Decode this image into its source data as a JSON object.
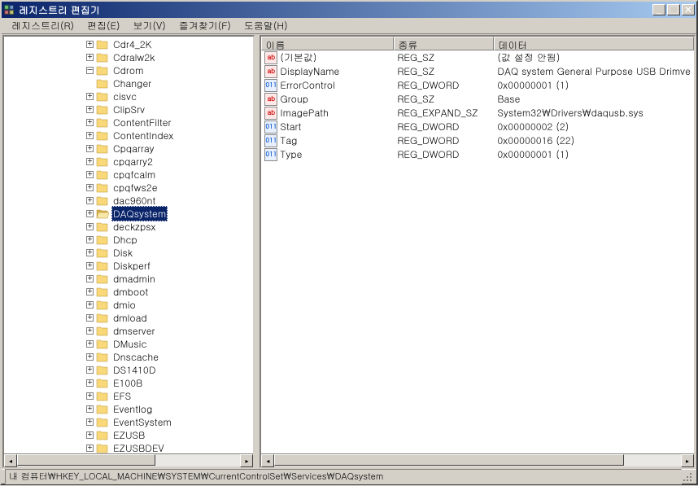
{
  "title": "레지스트리 편집기",
  "menu": {
    "registry": "레지스트리(R)",
    "edit": "편집(E)",
    "view": "보기(V)",
    "favorites": "즐겨찾기(F)",
    "help": "도움말(H)"
  },
  "tree": [
    {
      "label": "Cdr4_2K",
      "open": false,
      "selected": false
    },
    {
      "label": "Cdralw2k",
      "open": false,
      "selected": false
    },
    {
      "label": "Cdrom",
      "open": true,
      "selected": false
    },
    {
      "label": "Changer",
      "open": false,
      "selected": false,
      "noexpand": true
    },
    {
      "label": "cisvc",
      "open": false,
      "selected": false
    },
    {
      "label": "ClipSrv",
      "open": false,
      "selected": false
    },
    {
      "label": "ContentFilter",
      "open": false,
      "selected": false
    },
    {
      "label": "ContentIndex",
      "open": false,
      "selected": false
    },
    {
      "label": "Cpqarray",
      "open": false,
      "selected": false
    },
    {
      "label": "cpqarry2",
      "open": false,
      "selected": false
    },
    {
      "label": "cpqfcalm",
      "open": false,
      "selected": false
    },
    {
      "label": "cpqfws2e",
      "open": false,
      "selected": false
    },
    {
      "label": "dac960nt",
      "open": false,
      "selected": false
    },
    {
      "label": "DAQsystem",
      "open": false,
      "selected": true
    },
    {
      "label": "deckzpsx",
      "open": false,
      "selected": false
    },
    {
      "label": "Dhcp",
      "open": false,
      "selected": false
    },
    {
      "label": "Disk",
      "open": false,
      "selected": false
    },
    {
      "label": "Diskperf",
      "open": false,
      "selected": false
    },
    {
      "label": "dmadmin",
      "open": false,
      "selected": false
    },
    {
      "label": "dmboot",
      "open": false,
      "selected": false
    },
    {
      "label": "dmio",
      "open": false,
      "selected": false
    },
    {
      "label": "dmload",
      "open": false,
      "selected": false
    },
    {
      "label": "dmserver",
      "open": false,
      "selected": false
    },
    {
      "label": "DMusic",
      "open": false,
      "selected": false
    },
    {
      "label": "Dnscache",
      "open": false,
      "selected": false
    },
    {
      "label": "DS1410D",
      "open": false,
      "selected": false
    },
    {
      "label": "E100B",
      "open": false,
      "selected": false
    },
    {
      "label": "EFS",
      "open": false,
      "selected": false
    },
    {
      "label": "Eventlog",
      "open": false,
      "selected": false
    },
    {
      "label": "EventSystem",
      "open": false,
      "selected": false
    },
    {
      "label": "EZUSB",
      "open": false,
      "selected": false
    },
    {
      "label": "EZUSBDEV",
      "open": false,
      "selected": false
    }
  ],
  "columns": {
    "name": "이름",
    "type": "종류",
    "data": "데이터"
  },
  "values": [
    {
      "icon": "str",
      "name": "(기본값)",
      "type": "REG_SZ",
      "data": "(값 설정 안됨)"
    },
    {
      "icon": "str",
      "name": "DisplayName",
      "type": "REG_SZ",
      "data": "DAQ system General Purpose USB Drimve"
    },
    {
      "icon": "bin",
      "name": "ErrorControl",
      "type": "REG_DWORD",
      "data": "0x00000001 (1)"
    },
    {
      "icon": "str",
      "name": "Group",
      "type": "REG_SZ",
      "data": "Base"
    },
    {
      "icon": "str",
      "name": "ImagePath",
      "type": "REG_EXPAND_SZ",
      "data": "System32\\Drivers\\daqusb.sys"
    },
    {
      "icon": "bin",
      "name": "Start",
      "type": "REG_DWORD",
      "data": "0x00000002 (2)"
    },
    {
      "icon": "bin",
      "name": "Tag",
      "type": "REG_DWORD",
      "data": "0x00000016 (22)"
    },
    {
      "icon": "bin",
      "name": "Type",
      "type": "REG_DWORD",
      "data": "0x00000001 (1)"
    }
  ],
  "status": "내 컴퓨터\\HKEY_LOCAL_MACHINE\\SYSTEM\\CurrentControlSet\\Services\\DAQsystem"
}
